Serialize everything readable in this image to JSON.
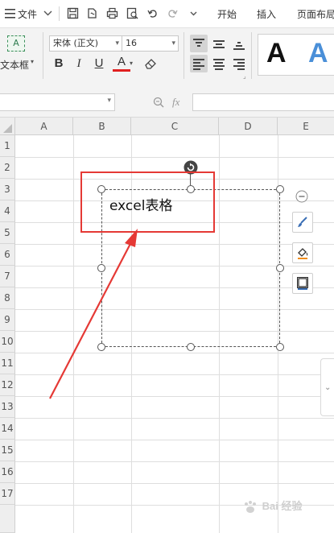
{
  "menubar": {
    "file_label": "文件",
    "tab_start": "开始",
    "tab_insert": "插入",
    "tab_layout": "页面布局"
  },
  "ribbon": {
    "textbox_label": "文本框",
    "textbox_icon_text": "A",
    "font_name": "宋体 (正文)",
    "font_size": "16",
    "bold": "B",
    "italic": "I",
    "underline": "U",
    "font_color": "A",
    "style_preview_dark": "A",
    "style_preview_blue": "A"
  },
  "formula_bar": {
    "fx_label": "fx"
  },
  "grid": {
    "columns": [
      "A",
      "B",
      "C",
      "D",
      "E"
    ],
    "rows": [
      "1",
      "2",
      "3",
      "4",
      "5",
      "6",
      "7",
      "8",
      "9",
      "10",
      "11",
      "12",
      "13",
      "14",
      "15",
      "16",
      "17"
    ]
  },
  "textbox": {
    "text": "excel表格"
  },
  "watermark": {
    "text": "Bai 经验"
  },
  "colors": {
    "annotation_red": "#e53935",
    "ribbon_bg": "#f3f3f3",
    "header_bg": "#eeeeee",
    "style_blue": "#4a8fd8",
    "font_color_red": "#e02020",
    "fill_orange": "#f08c1a"
  }
}
